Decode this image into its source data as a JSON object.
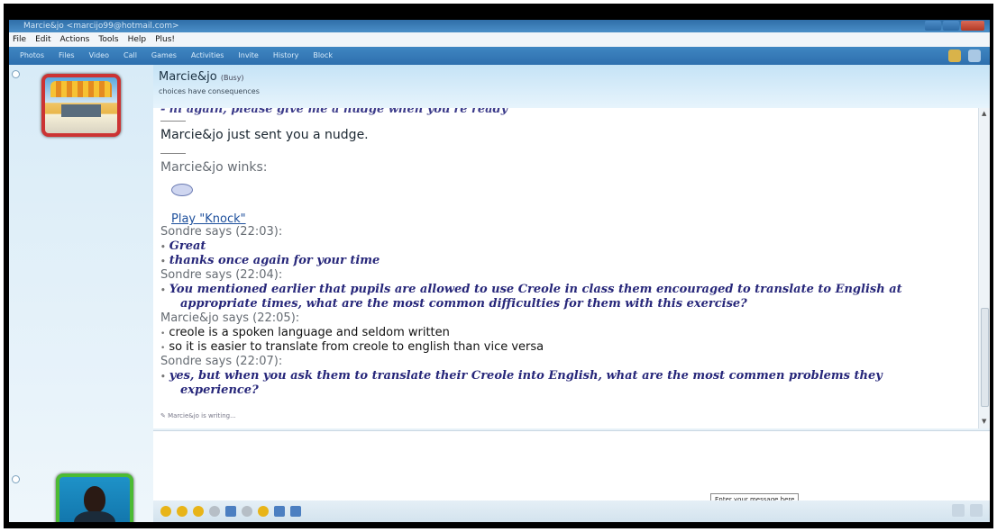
{
  "window": {
    "title": "Marcie&jo <marcijo99@hotmail.com>"
  },
  "menu": [
    "File",
    "Edit",
    "Actions",
    "Tools",
    "Help",
    "Plus!"
  ],
  "toolbar": [
    "Photos",
    "Files",
    "Video",
    "Call",
    "Games",
    "Activities",
    "Invite",
    "History",
    "Block"
  ],
  "contact": {
    "name": "Marcie&jo",
    "status": "(Busy)",
    "personal_message": "choices have consequences"
  },
  "conversation": {
    "partial_top": "- hi again, please give me a nudge when you're ready",
    "nudge": "Marcie&jo just sent you a nudge.",
    "wink_label": "Marcie&jo winks:",
    "wink_link": "Play \"Knock\"",
    "s1_header": "Sondre says (22:03):",
    "s1_l1": "Great",
    "s1_l2": "thanks once again for your time",
    "s2_header": "Sondre says (22:04):",
    "s2_l1": "You mentioned earlier that pupils are allowed to use Creole in class them encouraged to translate to English at",
    "s2_l2": "appropriate times, what are the most common difficulties for them with this exercise?",
    "m_header": "Marcie&jo says (22:05):",
    "m_l1": "creole is a spoken language and seldom written",
    "m_l2": "so it is easier to translate from creole to english than vice versa",
    "s3_header": "Sondre says (22:07):",
    "s3_l1": "yes, but when you ask them to translate their Creole into English, what are the most commen problems they",
    "s3_l2": "experience?",
    "typing": "Marcie&jo is writing..."
  },
  "input": {
    "tooltip": "Enter your message here"
  }
}
